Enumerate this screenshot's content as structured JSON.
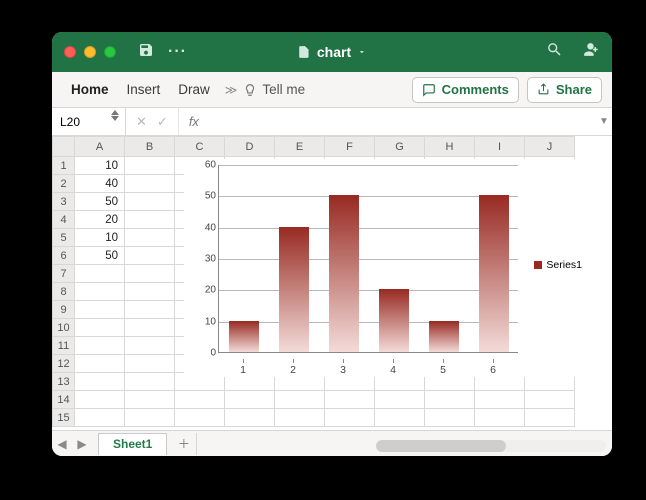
{
  "titlebar": {
    "filename": "chart"
  },
  "ribbon": {
    "home": "Home",
    "insert": "Insert",
    "draw": "Draw",
    "tellme": "Tell me",
    "comments": "Comments",
    "share": "Share"
  },
  "formula_bar": {
    "namebox": "L20",
    "fx_label": "fx",
    "formula": ""
  },
  "columns": [
    "A",
    "B",
    "C",
    "D",
    "E",
    "F",
    "G",
    "H",
    "I",
    "J"
  ],
  "rows": [
    1,
    2,
    3,
    4,
    5,
    6,
    7,
    8,
    9,
    10,
    11,
    12,
    13,
    14,
    15
  ],
  "cells": {
    "A1": "10",
    "A2": "40",
    "A3": "50",
    "A4": "20",
    "A5": "10",
    "A6": "50"
  },
  "sheets": {
    "active": "Sheet1"
  },
  "chart_data": {
    "type": "bar",
    "categories": [
      1,
      2,
      3,
      4,
      5,
      6
    ],
    "values": [
      10,
      40,
      50,
      20,
      10,
      50
    ],
    "series_name": "Series1",
    "ylim": [
      0,
      60
    ],
    "yticks": [
      0,
      10,
      20,
      30,
      40,
      50,
      60
    ]
  }
}
